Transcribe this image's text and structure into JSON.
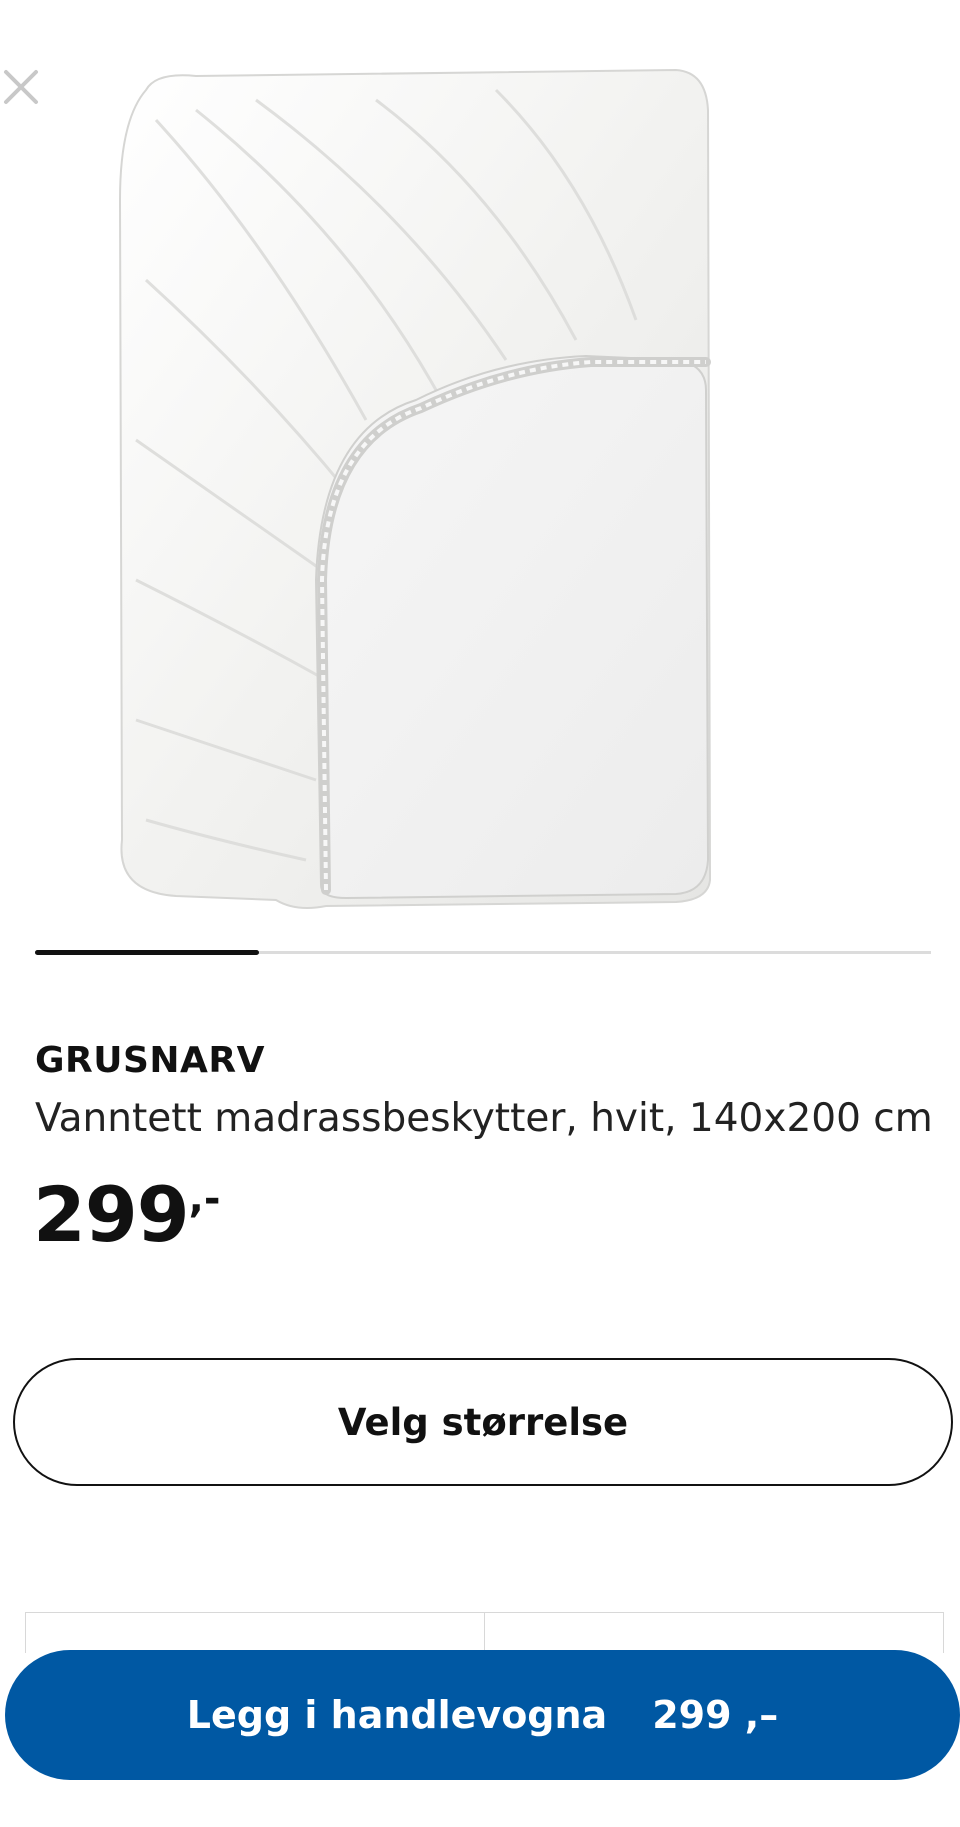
{
  "product": {
    "name": "GRUSNARV",
    "description": "Vanntett madrassbeskytter, hvit, 140x200 cm",
    "price_integer": "299",
    "price_suffix": ",-",
    "image_icon": "fitted-mattress-protector-image"
  },
  "carousel": {
    "active_index": 1,
    "total": 4,
    "progress": 0.25
  },
  "actions": {
    "size_label": "Velg størrelse",
    "cart_label": "Legg i handlevogna",
    "cart_price": "299 ,–"
  },
  "icons": {
    "close": "close-icon"
  },
  "colors": {
    "primary_button": "#0058a3",
    "primary_text": "#ffffff",
    "text": "#111111"
  }
}
